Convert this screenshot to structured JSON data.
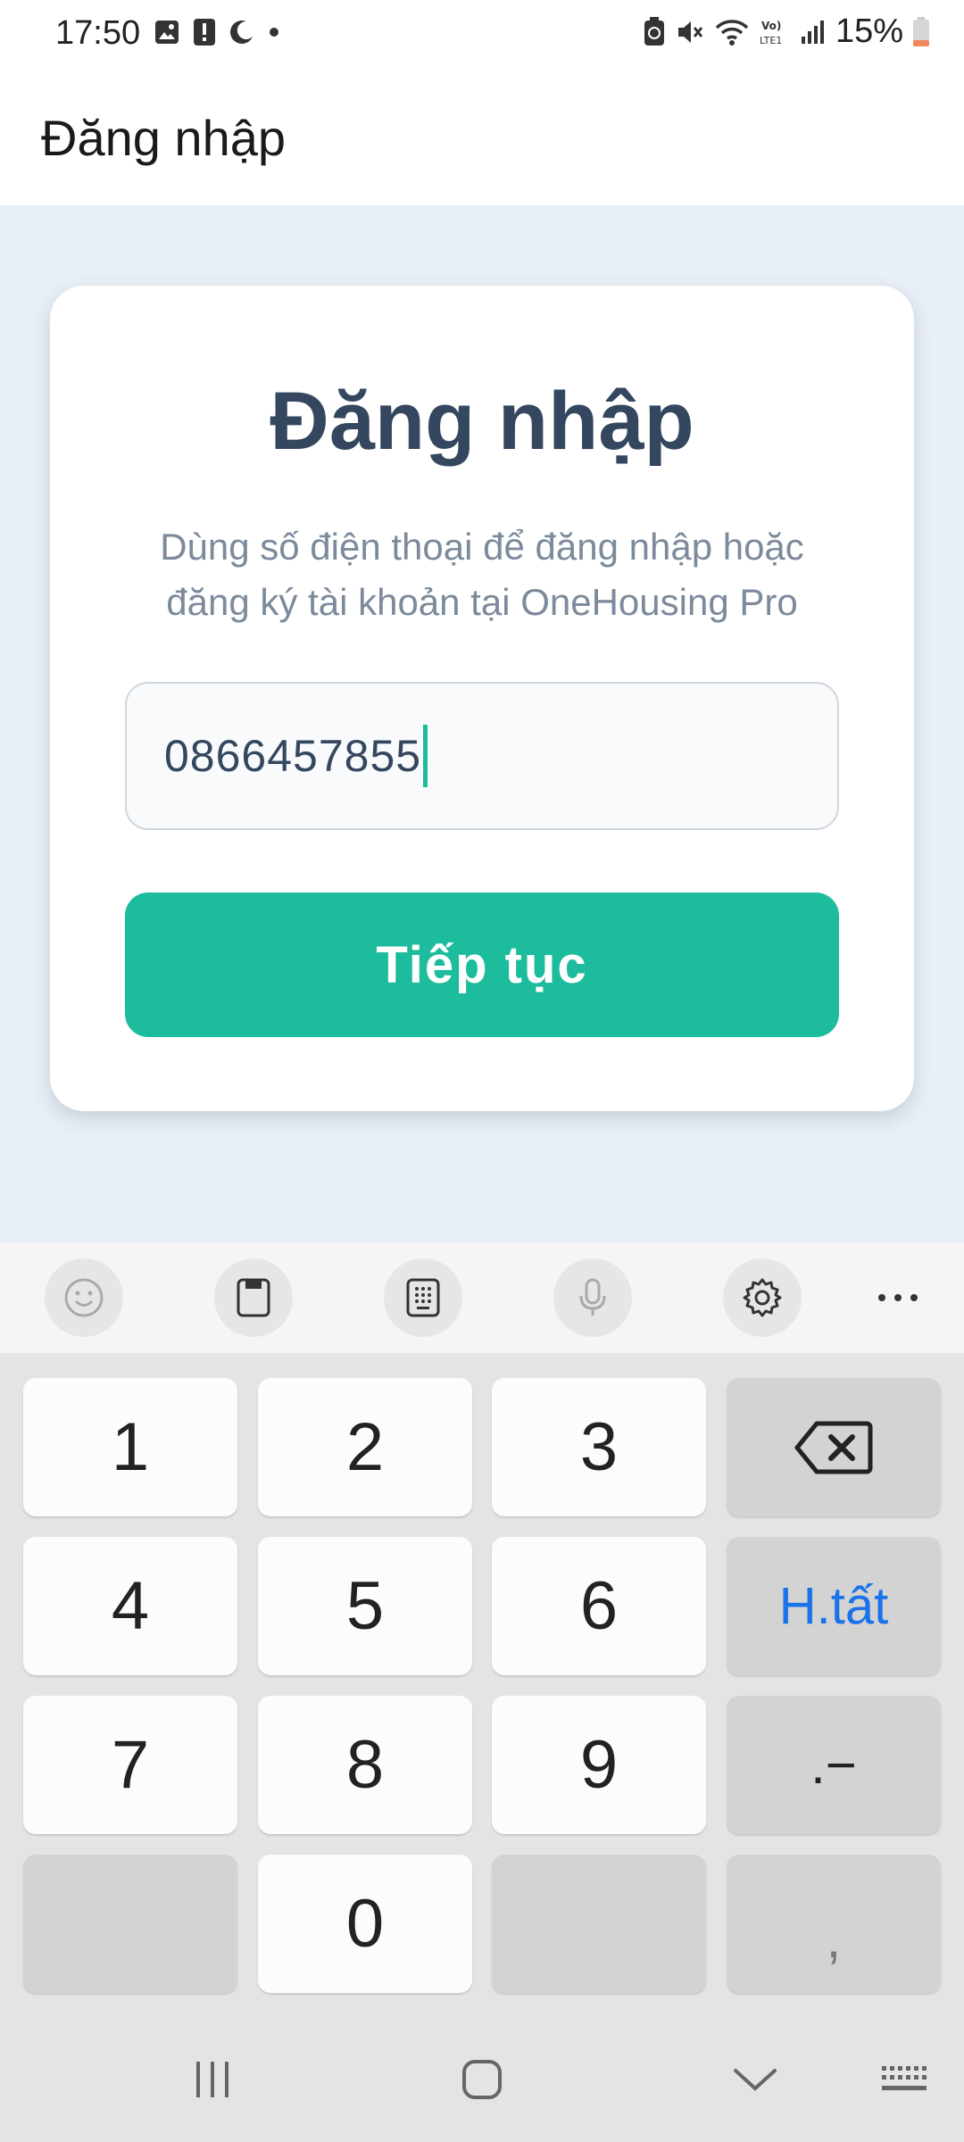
{
  "status_bar": {
    "time": "17:50",
    "battery": "15%",
    "battery_color": "#f08a5d",
    "icons_left": [
      "image-icon",
      "alert-icon",
      "moon-icon",
      "dot-icon"
    ],
    "icons_right": [
      "battery-saver-icon",
      "mute-icon",
      "wifi-icon",
      "volte-icon",
      "signal-icon",
      "battery-icon"
    ]
  },
  "app_bar": {
    "title": "Đăng nhập"
  },
  "card": {
    "title": "Đăng nhập",
    "subtitle": "Dùng số điện thoại để đăng nhập hoặc đăng ký tài khoản tại OneHousing Pro",
    "phone_value": "0866457855",
    "continue_label": "Tiếp tục",
    "accent_color": "#1cbc9c"
  },
  "keyboard_toolbar": {
    "icons": [
      "emoji-icon",
      "clipboard-icon",
      "keypad-icon",
      "mic-icon",
      "settings-icon",
      "more-icon"
    ]
  },
  "keyboard": {
    "keys": {
      "k1": "1",
      "k2": "2",
      "k3": "3",
      "k4": "4",
      "k5": "5",
      "k6": "6",
      "k7": "7",
      "k8": "8",
      "k9": "9",
      "k0": "0",
      "done": "H.tất",
      "dot_dash": ".−",
      "comma": ","
    }
  },
  "nav_bar": {
    "icons": [
      "recents-icon",
      "home-icon",
      "back-icon",
      "keyboard-switch-icon"
    ]
  }
}
